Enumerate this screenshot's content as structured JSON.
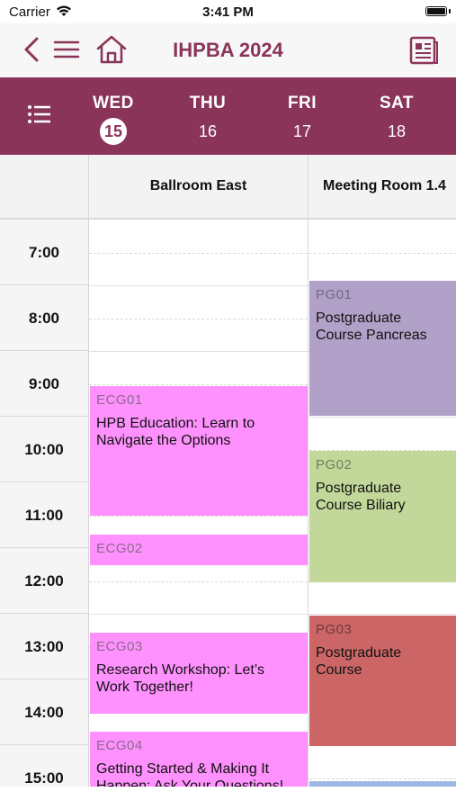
{
  "status_bar": {
    "carrier": "Carrier",
    "time": "3:41 PM"
  },
  "nav": {
    "title": "IHPBA 2024",
    "icons": [
      "back-chevron-icon",
      "hamburger-menu-icon",
      "home-icon",
      "notes-icon"
    ]
  },
  "days": [
    {
      "name": "WED",
      "number": "15",
      "selected": true
    },
    {
      "name": "THU",
      "number": "16",
      "selected": false
    },
    {
      "name": "FRI",
      "number": "17",
      "selected": false
    },
    {
      "name": "SAT",
      "number": "18",
      "selected": false
    }
  ],
  "rooms": [
    "Ballroom East",
    "Meeting Room 1.4"
  ],
  "times": [
    "7:00",
    "8:00",
    "9:00",
    "10:00",
    "11:00",
    "12:00",
    "13:00",
    "14:00",
    "15:00"
  ],
  "events": {
    "ecg01": {
      "code": "ECG01",
      "title": "HPB Education: Learn to Navigate the Options"
    },
    "ecg02": {
      "code": "ECG02",
      "title": ""
    },
    "ecg03": {
      "code": "ECG03",
      "title": "Research Workshop: Let’s Work Together!"
    },
    "ecg04": {
      "code": "ECG04",
      "title": "Getting Started & Making It Happen: Ask Your Questions!"
    },
    "pg01": {
      "code": "PG01",
      "title": "Postgraduate Course Pancreas"
    },
    "pg02": {
      "code": "PG02",
      "title": "Postgraduate Course Biliary"
    },
    "pg03": {
      "code": "PG03",
      "title": "Postgraduate Course"
    }
  },
  "colors": {
    "brand": "#8a3459",
    "ballroom_event": "#fe91fd",
    "pg01": "#b1a1c8",
    "pg02": "#c2d89a",
    "pg03": "#cc6666"
  }
}
